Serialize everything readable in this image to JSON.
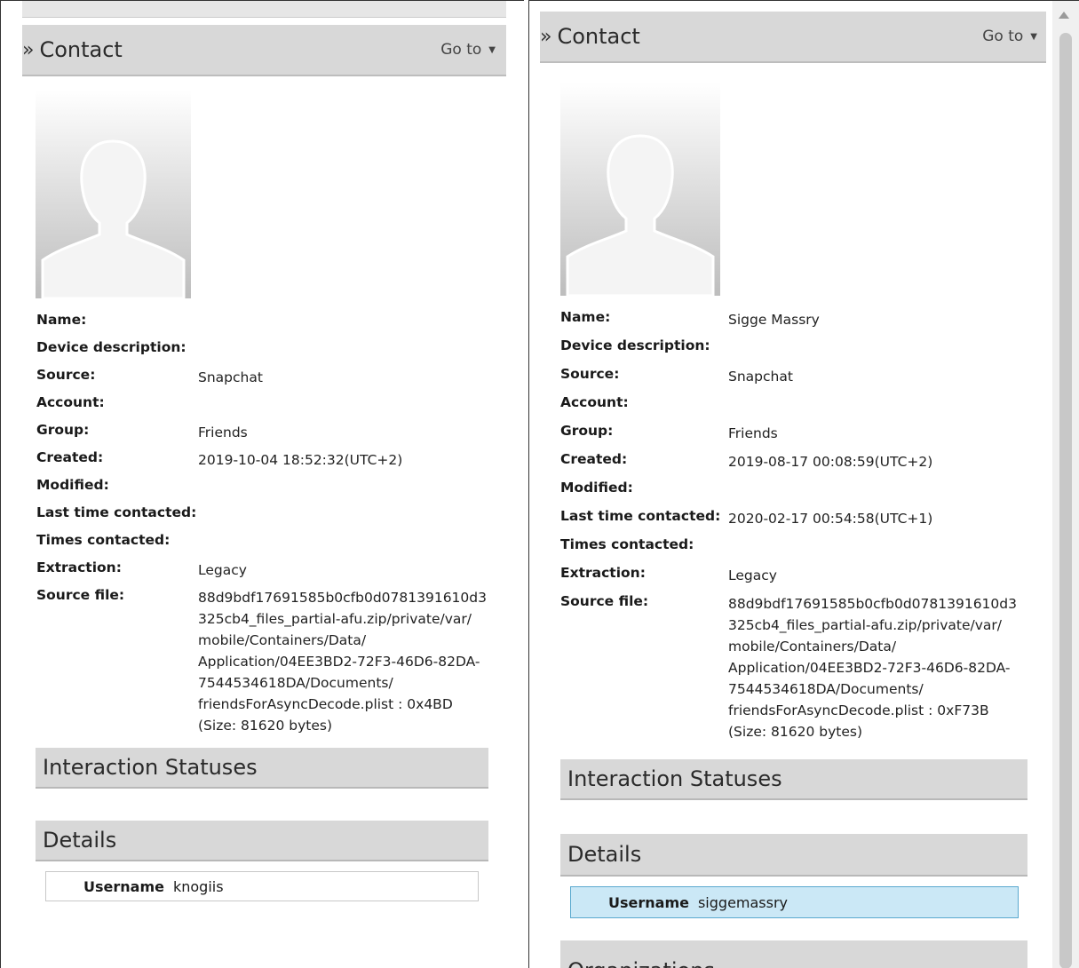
{
  "left": {
    "header": {
      "title": "Contact",
      "goto_label": "Go to"
    },
    "fields": [
      {
        "label": "Name:",
        "value": ""
      },
      {
        "label": "Device description:",
        "value": ""
      },
      {
        "label": "Source:",
        "value": "Snapchat"
      },
      {
        "label": "Account:",
        "value": ""
      },
      {
        "label": "Group:",
        "value": "Friends"
      },
      {
        "label": "Created:",
        "value": "2019-10-04 18:52:32(UTC+2)"
      },
      {
        "label": "Modified:",
        "value": ""
      },
      {
        "label": "Last time contacted:",
        "value": ""
      },
      {
        "label": "Times contacted:",
        "value": ""
      },
      {
        "label": "Extraction:",
        "value": "Legacy"
      },
      {
        "label": "Source file:",
        "value": "88d9bdf17691585b0cfb0d0781391610d3\n325cb4_files_partial-afu.zip/private/var/\nmobile/Containers/Data/\nApplication/04EE3BD2-72F3-46D6-82DA-\n7544534618DA/Documents/\nfriendsForAsyncDecode.plist : 0x4BD\n(Size: 81620 bytes)"
      }
    ],
    "sections": {
      "interaction": "Interaction Statuses",
      "details": "Details"
    },
    "details_row": {
      "key": "Username",
      "value": "knogiis"
    }
  },
  "right": {
    "header": {
      "title": "Contact",
      "goto_label": "Go to"
    },
    "fields": [
      {
        "label": "Name:",
        "value": "Sigge Massry"
      },
      {
        "label": "Device description:",
        "value": ""
      },
      {
        "label": "Source:",
        "value": "Snapchat"
      },
      {
        "label": "Account:",
        "value": ""
      },
      {
        "label": "Group:",
        "value": "Friends"
      },
      {
        "label": "Created:",
        "value": "2019-08-17 00:08:59(UTC+2)"
      },
      {
        "label": "Modified:",
        "value": ""
      },
      {
        "label": "Last time contacted:",
        "value": "2020-02-17 00:54:58(UTC+1)"
      },
      {
        "label": "Times contacted:",
        "value": ""
      },
      {
        "label": "Extraction:",
        "value": "Legacy"
      },
      {
        "label": "Source file:",
        "value": "88d9bdf17691585b0cfb0d0781391610d3\n325cb4_files_partial-afu.zip/private/var/\nmobile/Containers/Data/\nApplication/04EE3BD2-72F3-46D6-82DA-\n7544534618DA/Documents/\nfriendsForAsyncDecode.plist : 0xF73B\n(Size: 81620 bytes)"
      }
    ],
    "sections": {
      "interaction": "Interaction Statuses",
      "details": "Details",
      "organizations": "Organizations"
    },
    "details_row": {
      "key": "Username",
      "value": "siggemassry"
    }
  },
  "icons": {
    "header": "double-chevron-right-icon",
    "goto": "caret-down-icon",
    "avatar": "person-silhouette-icon"
  },
  "colors": {
    "header_bg": "#d8d8d8",
    "selected_row_bg": "#cbe8f6",
    "selected_row_border": "#5aa9cf"
  }
}
